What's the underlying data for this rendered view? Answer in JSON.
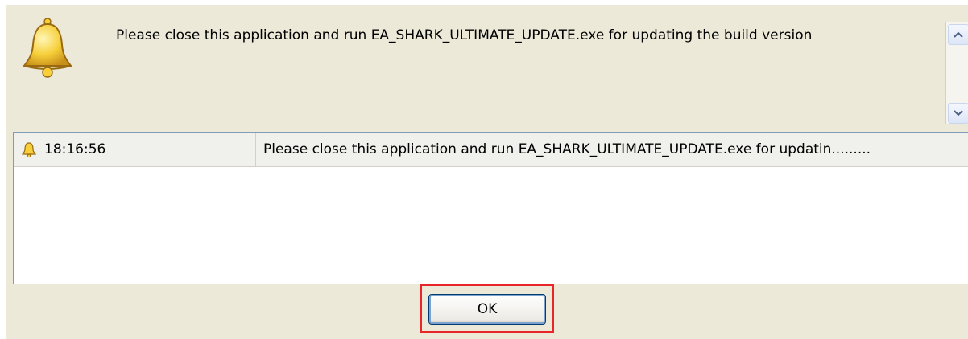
{
  "dialog": {
    "icon": "bell-icon",
    "message": "Please close this application and run EA_SHARK_ULTIMATE_UPDATE.exe for updating the build version"
  },
  "log": {
    "rows": [
      {
        "icon": "bell-icon",
        "time": "18:16:56",
        "message": "Please close this application and run EA_SHARK_ULTIMATE_UPDATE.exe for updatin........."
      }
    ]
  },
  "buttons": {
    "ok_label": "OK"
  },
  "colors": {
    "dialog_bg": "#ece9d8",
    "highlight": "#e8262a",
    "bell": "#f2c230"
  }
}
